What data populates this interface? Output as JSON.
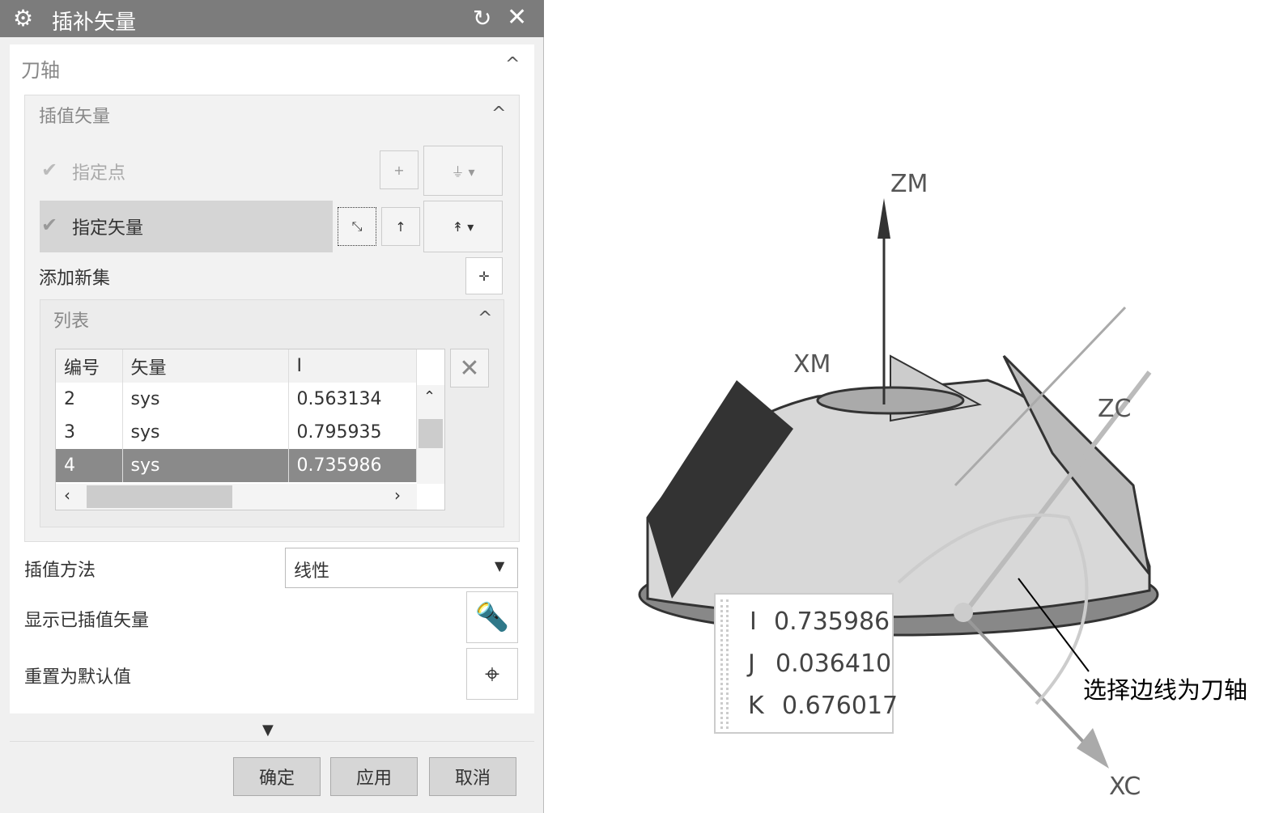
{
  "dialog": {
    "title": "插补矢量",
    "icons": [
      "gear-icon",
      "reset-icon",
      "close-icon"
    ]
  },
  "tool_axis": {
    "label": "刀轴"
  },
  "interp_vector": {
    "label": "插值矢量",
    "specify_point": "指定点",
    "specify_vector": "指定矢量",
    "add_new_set": "添加新集"
  },
  "list": {
    "label": "列表",
    "columns": [
      "编号",
      "矢量",
      "I"
    ],
    "rows": [
      {
        "id": "2",
        "vector": "sys",
        "i": "0.563134"
      },
      {
        "id": "3",
        "vector": "sys",
        "i": "0.795935"
      },
      {
        "id": "4",
        "vector": "sys",
        "i": "0.735986",
        "selected": true
      }
    ]
  },
  "method": {
    "label": "插值方法",
    "value": "线性"
  },
  "show_vectors": {
    "label": "显示已插值矢量"
  },
  "reset": {
    "label": "重置为默认值"
  },
  "footer": {
    "ok": "确定",
    "apply": "应用",
    "cancel": "取消"
  },
  "viewport": {
    "axes": {
      "zm": "ZM",
      "xm": "XM",
      "zc": "ZC",
      "xc": "XC"
    },
    "readout": {
      "i_label": "I",
      "i": "0.735986",
      "j_label": "J",
      "j": "0.036410",
      "k_label": "K",
      "k": "0.676017"
    },
    "annotation": "选择边线为刀轴"
  }
}
